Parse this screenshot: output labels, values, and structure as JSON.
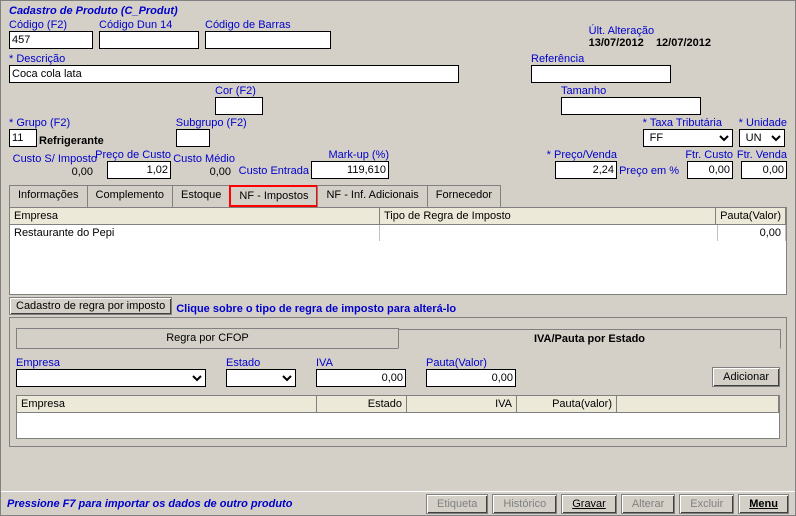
{
  "title": "Cadastro de Produto (C_Produt)",
  "header": {
    "codigo": {
      "label": "Código (F2)",
      "value": "457"
    },
    "dun14": {
      "label": "Código Dun 14",
      "value": ""
    },
    "barras": {
      "label": "Código de Barras",
      "value": ""
    },
    "ultalt": {
      "label": "Últ. Alteração",
      "date1": "13/07/2012",
      "date2": "12/07/2012"
    }
  },
  "desc": {
    "label": "Descrição",
    "value": "Coca cola lata"
  },
  "ref": {
    "label": "Referência",
    "value": ""
  },
  "cor": {
    "label": "Cor (F2)",
    "value": ""
  },
  "tam": {
    "label": "Tamanho",
    "value": ""
  },
  "grupo": {
    "label": "Grupo (F2)",
    "value": "11",
    "nome": "Refrigerante"
  },
  "subgrupo": {
    "label": "Subgrupo (F2)",
    "value": ""
  },
  "taxa": {
    "label": "Taxa Tributária",
    "value": "FF"
  },
  "unidade": {
    "label": "Unidade",
    "value": "UN"
  },
  "custos": {
    "simp": {
      "label": "Custo S/ Imposto",
      "value": "0,00"
    },
    "pcusto": {
      "label": "Preço de Custo",
      "value": "1,02"
    },
    "cmedio": {
      "label": "Custo Médio",
      "value": "0,00"
    },
    "centrada": {
      "label": "Custo Entrada",
      "value": ""
    },
    "markup": {
      "label": "Mark-up (%)",
      "value": "119,610"
    },
    "pvenda": {
      "label": "Preço/Venda",
      "value": "2,24"
    },
    "ppct": {
      "label": "Preço em %",
      "value": ""
    },
    "fcusto": {
      "label": "Ftr. Custo",
      "value": "0,00"
    },
    "fvenda": {
      "label": "Ftr. Venda",
      "value": "0,00"
    }
  },
  "tabs": {
    "info": "Informações",
    "compl": "Complemento",
    "estoque": "Estoque",
    "nfimp": "NF - Impostos",
    "nfadic": "NF - Inf. Adicionais",
    "forn": "Fornecedor"
  },
  "grid1": {
    "col_empresa": "Empresa",
    "col_tipo": "Tipo de Regra de Imposto",
    "col_pauta": "Pauta(Valor)",
    "row1_empresa": "Restaurante do Pepi",
    "row1_tipo": "",
    "row1_pauta": "0,00"
  },
  "regra_btn": "Cadastro de regra por imposto",
  "regra_hint": "Clique sobre o tipo de regra de imposto para alterá-lo",
  "subtabs": {
    "cfop": "Regra por CFOP",
    "iva": "IVA/Pauta por Estado"
  },
  "iva_form": {
    "empresa": "Empresa",
    "estado": "Estado",
    "iva": "IVA",
    "iva_val": "0,00",
    "pauta": "Pauta(Valor)",
    "pauta_val": "0,00",
    "adicionar": "Adicionar"
  },
  "grid2": {
    "col_empresa": "Empresa",
    "col_estado": "Estado",
    "col_iva": "IVA",
    "col_pauta": "Pauta(valor)"
  },
  "footer": {
    "hint": "Pressione F7 para importar os dados de outro produto",
    "etiqueta": "Etiqueta",
    "historico": "Histórico",
    "gravar": "Gravar",
    "alterar": "Alterar",
    "excluir": "Excluir",
    "menu": "Menu"
  }
}
